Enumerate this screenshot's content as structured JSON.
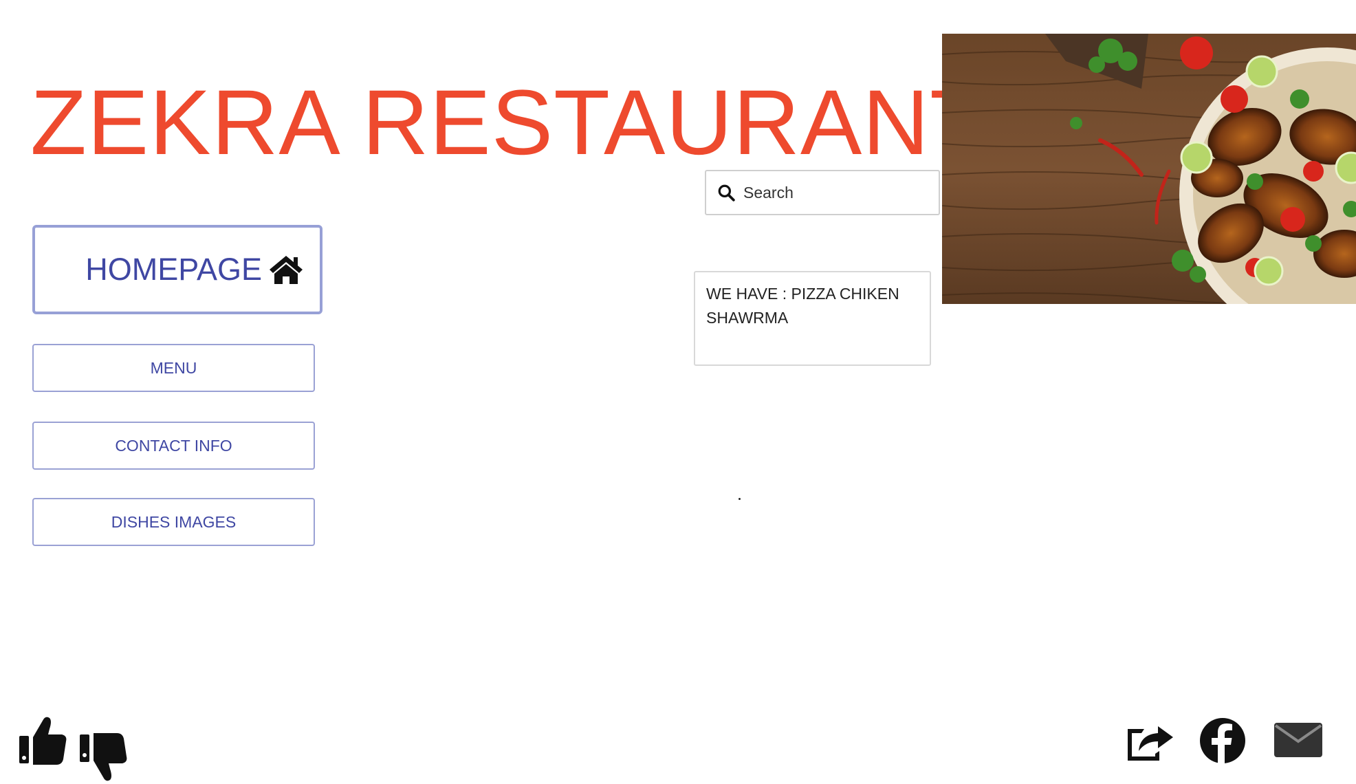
{
  "header": {
    "title": "ZEKRA RESTAURANT"
  },
  "hero_image": {
    "icon": "food-photo"
  },
  "search": {
    "placeholder": "Search",
    "icon": "search-icon"
  },
  "info_box": {
    "text": "WE HAVE : PIZZA CHIKEN SHAWRMA"
  },
  "nav": {
    "homepage_label": "HOMEPAGE",
    "homepage_icon": "home-icon",
    "items": [
      {
        "label": "MENU"
      },
      {
        "label": "CONTACT INFO"
      },
      {
        "label": "DISHES IMAGES"
      }
    ]
  },
  "footer": {
    "left_icons": [
      "thumbs-up-icon",
      "thumbs-down-icon"
    ],
    "right_icons": [
      "share-icon",
      "facebook-icon",
      "mail-icon"
    ]
  },
  "colors": {
    "title": "#ee4a2e",
    "accent": "#3f47a3",
    "border": "#97a0d6"
  }
}
